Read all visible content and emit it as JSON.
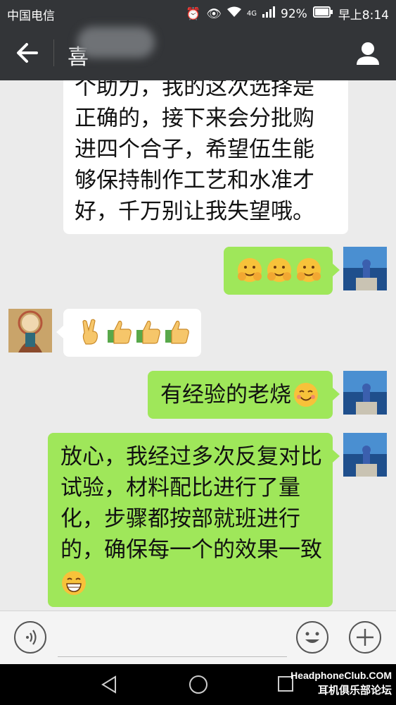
{
  "status": {
    "carrier": "中国电信",
    "battery": "92%",
    "time": "早上8:14",
    "network": "4G"
  },
  "header": {
    "title": "喜"
  },
  "messages": [
    {
      "side": "left",
      "text": "个助力，我的这次选择是\n正确的，接下来会分批购\n进四个合子，希望伍生能\n够保持制作工艺和水准才\n好，千万别让我失望哦。"
    },
    {
      "side": "right",
      "emoji": [
        "hug",
        "hug",
        "hug"
      ]
    },
    {
      "side": "left",
      "emoji": [
        "victory",
        "thumbs-up",
        "thumbs-up",
        "thumbs-up"
      ]
    },
    {
      "side": "right",
      "text": "有经验的老烧"
    },
    {
      "side": "right",
      "text": "放心，我经过多次反复对比\n试验，材料配比进行了量\n化，步骤都按部就班进行\n的，确保每一个的效果一致"
    }
  ],
  "watermark": {
    "line1": "HeadphoneClub.COM",
    "line2": "耳机俱乐部论坛"
  }
}
